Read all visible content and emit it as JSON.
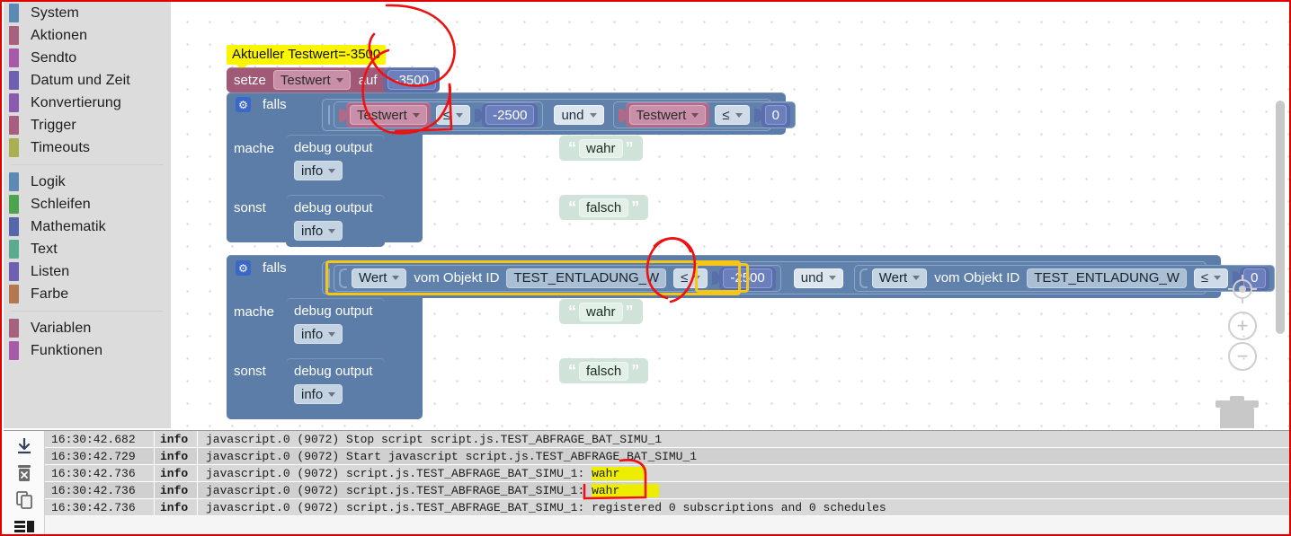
{
  "toolbox": {
    "groups": [
      {
        "items": [
          {
            "label": "System",
            "color": "#5b8ab5"
          },
          {
            "label": "Aktionen",
            "color": "#a8607f"
          },
          {
            "label": "Sendto",
            "color": "#a85aaa"
          },
          {
            "label": "Datum und Zeit",
            "color": "#6f5fb0"
          },
          {
            "label": "Konvertierung",
            "color": "#8a5aae"
          },
          {
            "label": "Trigger",
            "color": "#a85f7f"
          },
          {
            "label": "Timeouts",
            "color": "#a8b050"
          }
        ]
      },
      {
        "items": [
          {
            "label": "Logik",
            "color": "#5b8ab5"
          },
          {
            "label": "Schleifen",
            "color": "#4ea34e"
          },
          {
            "label": "Mathematik",
            "color": "#5566ad"
          },
          {
            "label": "Text",
            "color": "#5aab92"
          },
          {
            "label": "Listen",
            "color": "#6f5fb0"
          },
          {
            "label": "Farbe",
            "color": "#b5784c"
          }
        ]
      },
      {
        "items": [
          {
            "label": "Variablen",
            "color": "#a8607f"
          },
          {
            "label": "Funktionen",
            "color": "#a85aaa"
          }
        ]
      }
    ]
  },
  "canvas": {
    "tooltip": {
      "text": "Aktueller Testwert=-3500"
    },
    "set_block": {
      "keyword_set": "setze",
      "variable": "Testwert",
      "keyword_to": "auf",
      "value": "-3500"
    },
    "if_block_1": {
      "keyword_if": "falls",
      "keyword_do": "mache",
      "keyword_else": "sonst",
      "condition": {
        "left": {
          "variable": "Testwert",
          "operator": "≤",
          "value": "-2500"
        },
        "joiner": "und",
        "right": {
          "variable": "Testwert",
          "operator": "≤",
          "value": "0"
        }
      },
      "do_output": {
        "title": "debug output",
        "level": "info",
        "text": "wahr"
      },
      "else_output": {
        "title": "debug output",
        "level": "info",
        "text": "falsch"
      }
    },
    "if_block_2": {
      "keyword_if": "falls",
      "keyword_do": "mache",
      "keyword_else": "sonst",
      "condition": {
        "left": {
          "attribute": "Wert",
          "label": "vom Objekt ID",
          "object_id": "TEST_ENTLADUNG_W",
          "operator": "≤",
          "value": "-2500"
        },
        "joiner": "und",
        "right": {
          "attribute": "Wert",
          "label": "vom Objekt ID",
          "object_id": "TEST_ENTLADUNG_W",
          "operator": "≤",
          "value": "0"
        }
      },
      "do_output": {
        "title": "debug output",
        "level": "info",
        "text": "wahr"
      },
      "else_output": {
        "title": "debug output",
        "level": "info",
        "text": "falsch"
      }
    },
    "controls": {
      "center_label": "center-target-icon",
      "zoom_in": "+",
      "zoom_out": "−",
      "trash": "trash-icon"
    }
  },
  "log": {
    "tools": [
      {
        "name": "download-icon",
        "glyph": "↓"
      },
      {
        "name": "delete-icon",
        "glyph": "🗑"
      },
      {
        "name": "copy-icon",
        "glyph": "⧉"
      },
      {
        "name": "list-icon",
        "glyph": "≡"
      }
    ],
    "columns": [
      "time",
      "level",
      "message"
    ],
    "rows": [
      {
        "time": "16:30:42.682",
        "level": "info",
        "message": "javascript.0 (9072) Stop script script.js.TEST_ABFRAGE_BAT_SIMU_1",
        "highlight": ""
      },
      {
        "time": "16:30:42.729",
        "level": "info",
        "message": "javascript.0 (9072) Start javascript script.js.TEST_ABFRAGE_BAT_SIMU_1",
        "highlight": ""
      },
      {
        "time": "16:30:42.736",
        "level": "info",
        "message": "javascript.0 (9072) script.js.TEST_ABFRAGE_BAT_SIMU_1: ",
        "highlight": "wahr"
      },
      {
        "time": "16:30:42.736",
        "level": "info",
        "message": "javascript.0 (9072) script.js.TEST_ABFRAGE_BAT_SIMU_1: ",
        "highlight": "wahr"
      },
      {
        "time": "16:30:42.736",
        "level": "info",
        "message": "javascript.0 (9072) script.js.TEST_ABFRAGE_BAT_SIMU_1: registered 0 subscriptions and 0 schedules",
        "highlight": ""
      }
    ]
  },
  "colors": {
    "annotation_red": "#ee1111",
    "highlight_yellow": "#f5c518",
    "tooltip_yellow": "#fcf500",
    "control_blue": "#5b7da8",
    "variable_pink": "#a05a78",
    "math_blue": "#5a6eab",
    "text_green": "#cfe3d8"
  }
}
